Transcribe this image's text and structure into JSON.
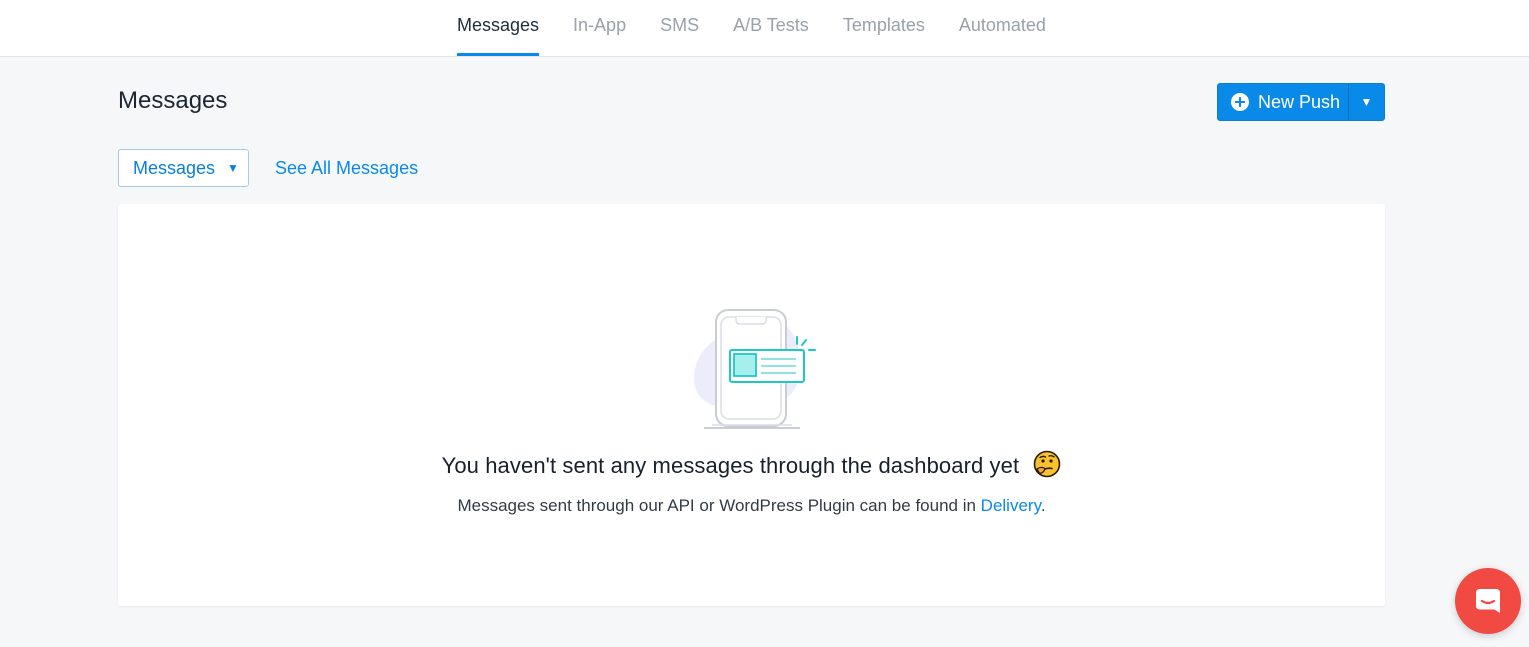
{
  "nav": {
    "tabs": [
      {
        "label": "Messages",
        "active": true
      },
      {
        "label": "In-App",
        "active": false
      },
      {
        "label": "SMS",
        "active": false
      },
      {
        "label": "A/B Tests",
        "active": false
      },
      {
        "label": "Templates",
        "active": false
      },
      {
        "label": "Automated",
        "active": false
      }
    ]
  },
  "header": {
    "title": "Messages",
    "new_push_label": "New Push",
    "new_push_icon": "plus-circle-icon",
    "dropdown_icon": "caret-down-icon"
  },
  "filter": {
    "selected": "Messages",
    "see_all_label": "See All Messages"
  },
  "empty_state": {
    "illustration": "phone-notification-illustration",
    "heading": "You haven't sent any messages through the dashboard yet",
    "emoji": "thinking-face-icon",
    "sub_prefix": "Messages sent through our API or WordPress Plugin can be found in ",
    "sub_link": "Delivery",
    "sub_suffix": "."
  },
  "chat": {
    "icon": "chat-bubble-icon"
  },
  "colors": {
    "accent": "#0a8ae8",
    "background": "#f6f7f9",
    "chat": "#f04a43"
  }
}
